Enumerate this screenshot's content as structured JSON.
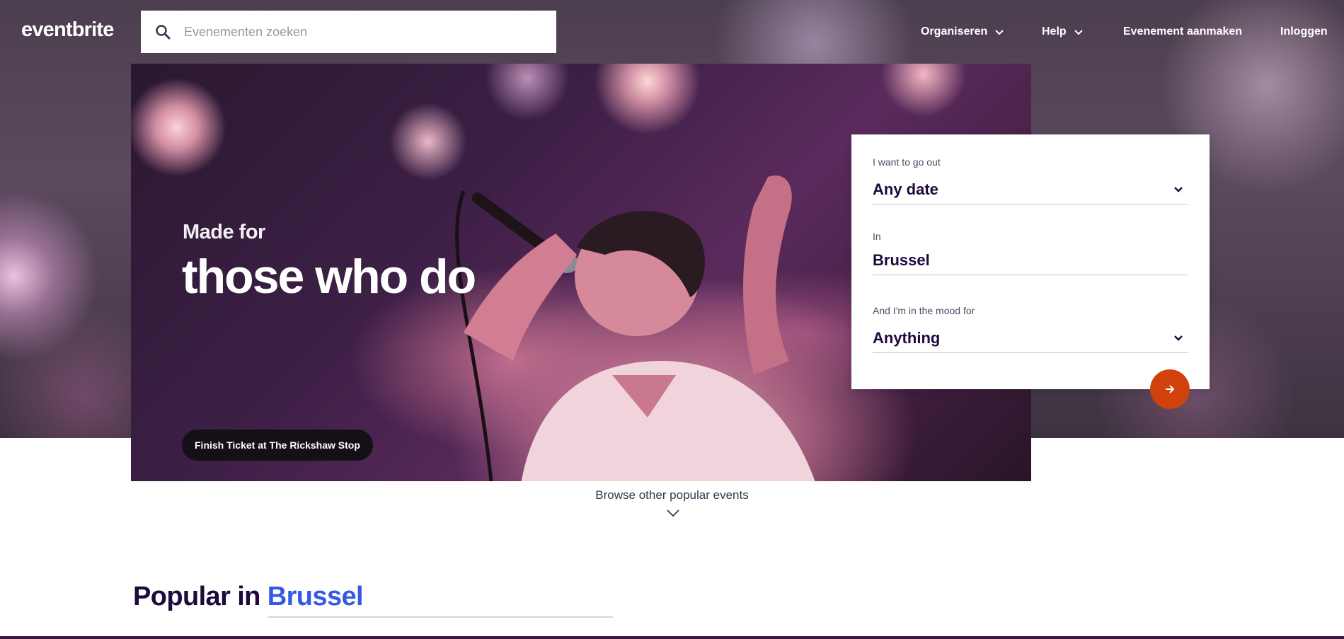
{
  "header": {
    "logo": "eventbrite",
    "search_placeholder": "Evenementen zoeken",
    "nav": {
      "organize": "Organiseren",
      "help": "Help",
      "create_event": "Evenement aanmaken",
      "login": "Inloggen"
    }
  },
  "hero": {
    "subtitle": "Made for",
    "title": "those who do",
    "credit": "Finish Ticket at The Rickshaw Stop"
  },
  "search_panel": {
    "date_label": "I want to go out",
    "date_value": "Any date",
    "location_label": "In",
    "location_value": "Brussel",
    "mood_label": "And I'm in the mood for",
    "mood_value": "Anything"
  },
  "browse": {
    "label": "Browse other popular events"
  },
  "popular": {
    "prefix": "Popular in",
    "city": "Brussel"
  },
  "colors": {
    "accent": "#d1410c",
    "link_blue": "#3659e3",
    "text_dark": "#1e0a3c"
  }
}
